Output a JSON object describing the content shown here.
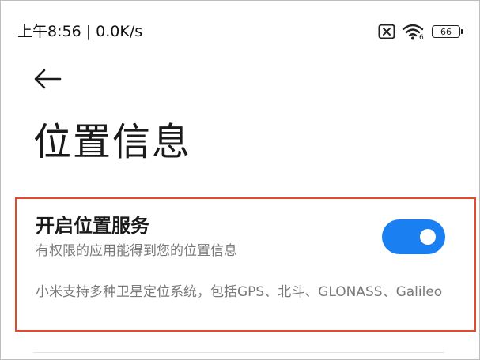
{
  "status_bar": {
    "time_speed": "上午8:56 | 0.0K/s",
    "sim_icon": "sim-disabled-icon",
    "wifi_icon": "wifi-6-icon",
    "wifi_label": "6",
    "battery_level": "66"
  },
  "header": {
    "back_icon": "back-arrow-icon",
    "title": "位置信息"
  },
  "location_setting": {
    "title": "开启位置服务",
    "subtitle": "有权限的应用能得到您的位置信息",
    "description": "小米支持多种卫星定位系统，包括GPS、北斗、GLONASS、Galileo",
    "enabled": true
  },
  "colors": {
    "toggle_on": "#1a7ff0",
    "highlight_border": "#e24a2e"
  }
}
